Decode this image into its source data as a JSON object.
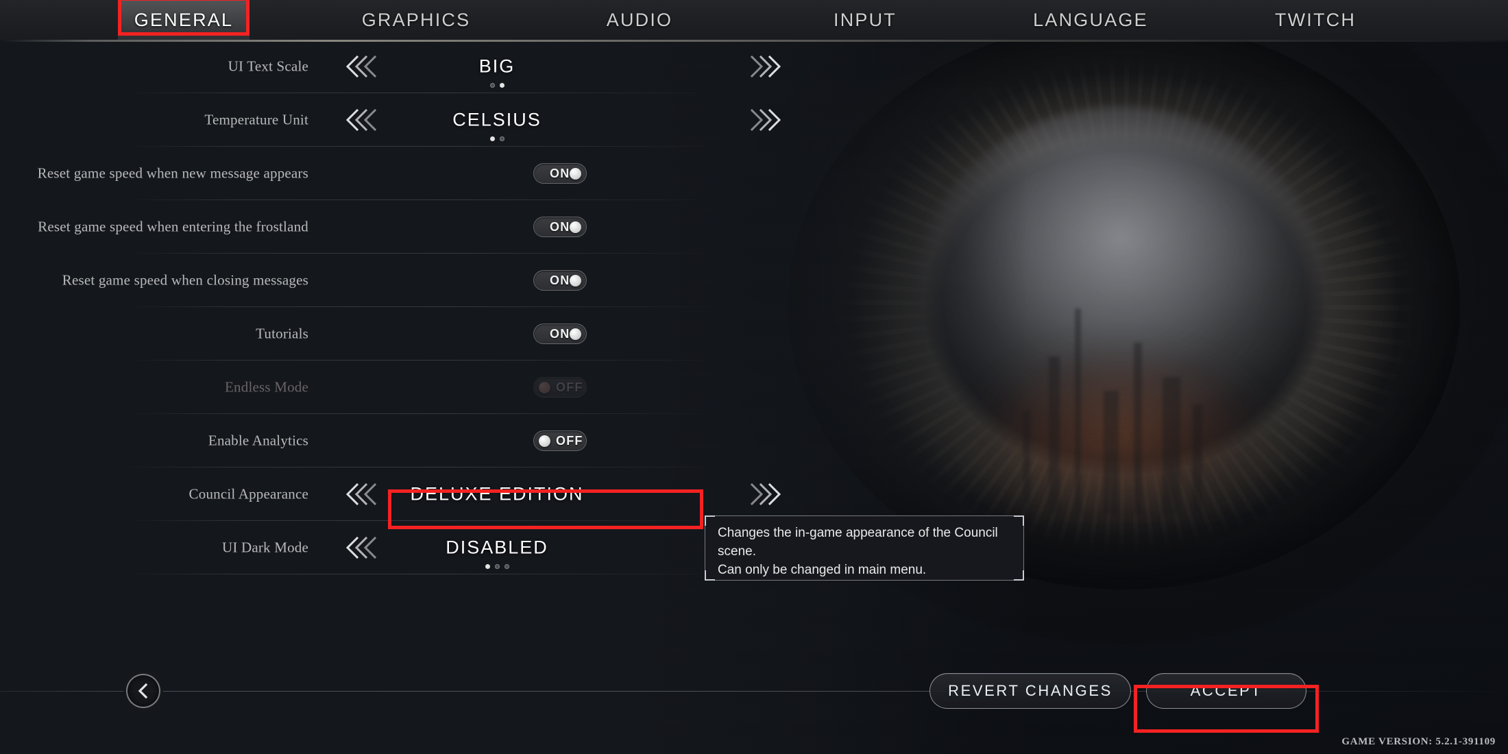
{
  "nav": {
    "tabs": [
      {
        "label": "GENERAL",
        "active": true
      },
      {
        "label": "GRAPHICS",
        "active": false
      },
      {
        "label": "AUDIO",
        "active": false
      },
      {
        "label": "INPUT",
        "active": false
      },
      {
        "label": "LANGUAGE",
        "active": false
      },
      {
        "label": "TWITCH",
        "active": false
      }
    ]
  },
  "settings": [
    {
      "label": "UI Text Scale",
      "type": "stepper",
      "value": "BIG",
      "dots": 2,
      "active_dot": 1,
      "disabled": false
    },
    {
      "label": "Temperature Unit",
      "type": "stepper",
      "value": "CELSIUS",
      "dots": 2,
      "active_dot": 0,
      "disabled": false
    },
    {
      "label": "Reset game speed when new message appears",
      "type": "toggle",
      "value": "ON",
      "disabled": false
    },
    {
      "label": "Reset game speed when entering the frostland",
      "type": "toggle",
      "value": "ON",
      "disabled": false
    },
    {
      "label": "Reset game speed when closing messages",
      "type": "toggle",
      "value": "ON",
      "disabled": false
    },
    {
      "label": "Tutorials",
      "type": "toggle",
      "value": "ON",
      "disabled": false
    },
    {
      "label": "Endless Mode",
      "type": "toggle",
      "value": "OFF",
      "disabled": true
    },
    {
      "label": "Enable Analytics",
      "type": "toggle",
      "value": "OFF",
      "disabled": false
    },
    {
      "label": "Council Appearance",
      "type": "stepper",
      "value": "DELUXE EDITION",
      "dots": 0,
      "active_dot": -1,
      "disabled": false
    },
    {
      "label": "UI Dark Mode",
      "type": "stepper",
      "value": "DISABLED",
      "dots": 3,
      "active_dot": 0,
      "disabled": false
    }
  ],
  "tooltip": {
    "line1": "Changes the in-game appearance of the Council",
    "line2": "scene.",
    "line3": "Can only be changed in main menu."
  },
  "bottom": {
    "back_icon": "chevron-left-icon",
    "revert_label": "REVERT CHANGES",
    "accept_label": "ACCEPT",
    "game_version": "GAME VERSION: 5.2.1-391109"
  },
  "annotations": {
    "highlight_color": "#f42222",
    "boxes": [
      "general-tab",
      "council-appearance-value",
      "accept-button"
    ]
  },
  "icons": {
    "chevron_left_triple": "chevron-left-triple-icon",
    "chevron_right_triple": "chevron-right-triple-icon"
  }
}
